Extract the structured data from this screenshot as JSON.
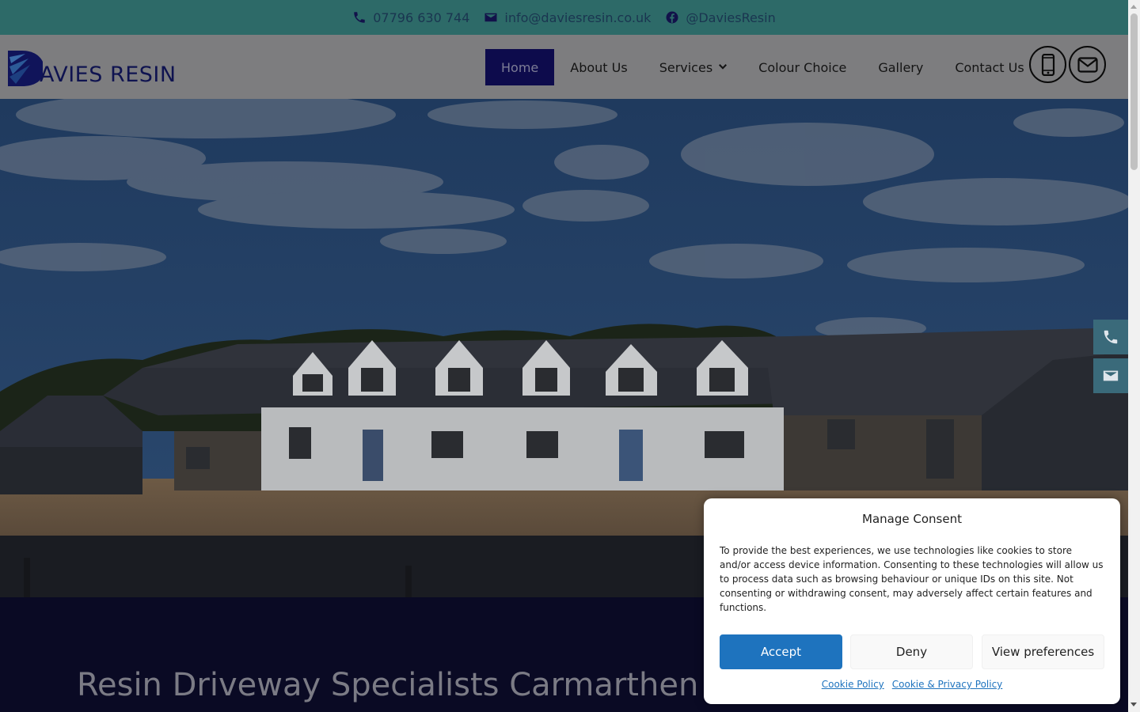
{
  "topbar": {
    "phone": "07796 630 744",
    "email": "info@daviesresin.co.uk",
    "social": "@DaviesResin",
    "icons": [
      "phone-icon",
      "envelope-icon",
      "facebook-icon"
    ]
  },
  "header": {
    "logo_text": "AVIES RESIN",
    "nav": [
      {
        "label": "Home",
        "active": true
      },
      {
        "label": "About Us"
      },
      {
        "label": "Services",
        "has_dropdown": true
      },
      {
        "label": "Colour Choice"
      },
      {
        "label": "Gallery"
      },
      {
        "label": "Contact Us"
      }
    ],
    "icons": [
      "mobile-phone-icon",
      "envelope-icon"
    ]
  },
  "side_buttons": [
    "phone-icon",
    "envelope-icon"
  ],
  "hero": {
    "heading": "Resin Driveway Specialists Carmarthen"
  },
  "consent": {
    "title": "Manage Consent",
    "body": "To provide the best experiences, we use technologies like cookies to store and/or access device information. Consenting to these technologies will allow us to process data such as browsing behaviour or unique IDs on this site. Not consenting or withdrawing consent, may adversely affect certain features and functions.",
    "accept_label": "Accept",
    "deny_label": "Deny",
    "preferences_label": "View preferences",
    "links": [
      "Cookie Policy",
      "Cookie & Privacy Policy"
    ]
  },
  "colors": {
    "topbar": "#2d6a68",
    "nav_active": "#0d0b4c",
    "accent": "#1e73be",
    "side_button": "#3a6a7a"
  }
}
